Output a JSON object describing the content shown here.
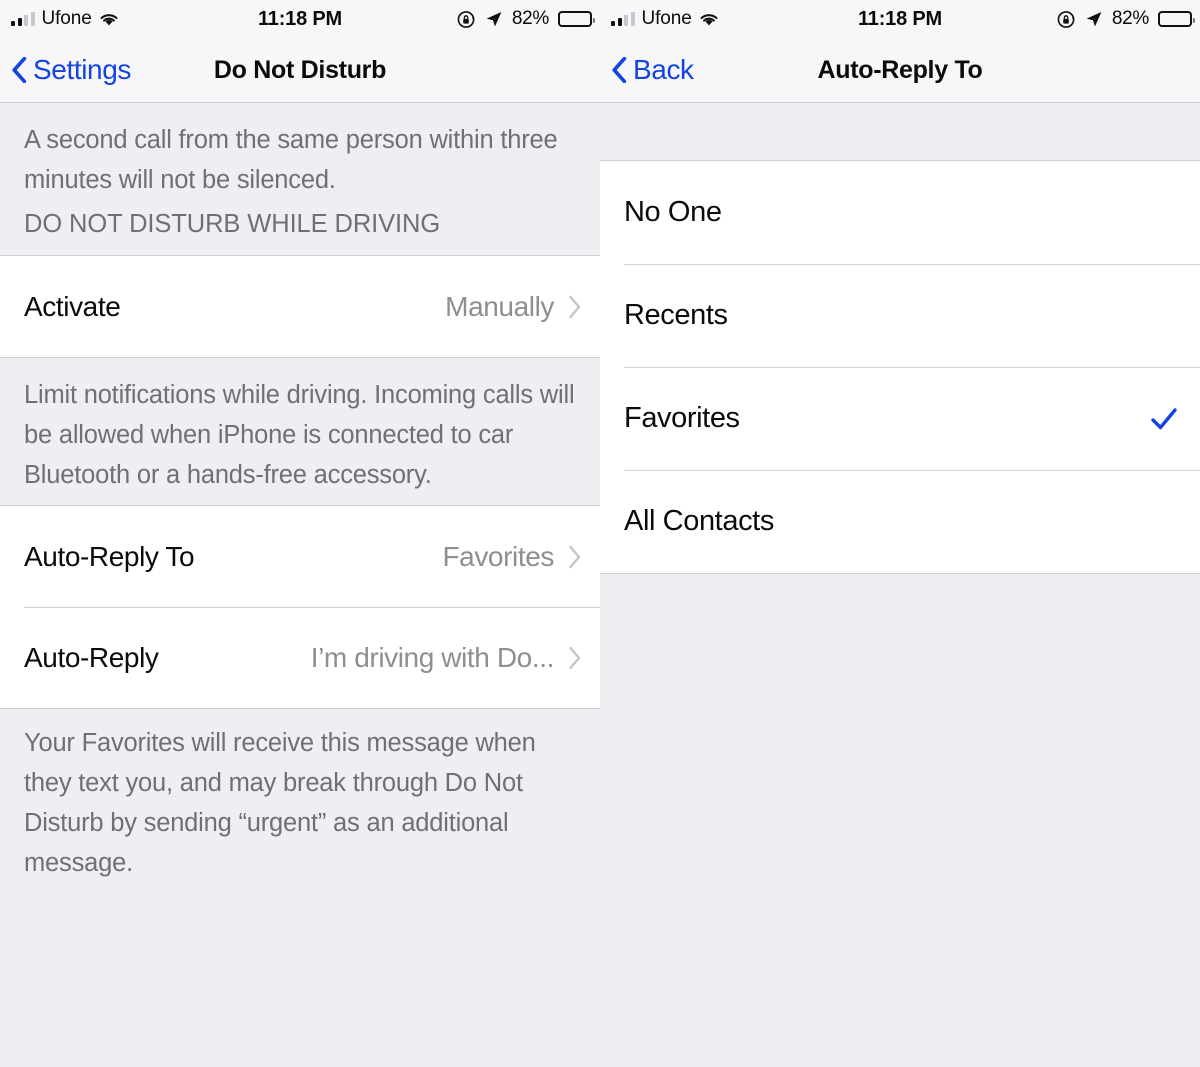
{
  "theme": {
    "accent_blue": "#1344e0",
    "background_gray": "#eeeef3",
    "card_white": "#ffffff",
    "separator": "#cfcfd4",
    "secondary_text": "#8e8e93",
    "footer_text": "#6f6f76"
  },
  "left_screen": {
    "status_bar": {
      "carrier": "Ufone",
      "signal_bars_filled": 2,
      "signal_bars_total": 4,
      "wifi_icon": "wifi-icon",
      "time": "11:18 PM",
      "rotation_lock_icon": "rotation-lock-icon",
      "location_icon": "location-arrow-icon",
      "battery_percent": "82%",
      "battery_icon": "battery-icon"
    },
    "nav": {
      "back_icon": "chevron-left-icon",
      "back_label": "Settings",
      "title": "Do Not Disturb"
    },
    "phone_call_footer": "A second call from the same person within three minutes will not be silenced.",
    "driving_section_header": "DO NOT DISTURB WHILE DRIVING",
    "activate_row": {
      "label": "Activate",
      "value": "Manually",
      "chevron_icon": "chevron-right-icon"
    },
    "driving_footer": "Limit notifications while driving. Incoming calls will be allowed when iPhone is connected to car Bluetooth or a hands-free accessory.",
    "auto_reply_rows": [
      {
        "label": "Auto-Reply To",
        "value": "Favorites",
        "chevron_icon": "chevron-right-icon"
      },
      {
        "label": "Auto-Reply",
        "value": "I’m driving with Do...",
        "chevron_icon": "chevron-right-icon"
      }
    ],
    "auto_reply_footer": "Your Favorites will receive this message when they text you, and may break through Do Not Disturb by sending “urgent” as an additional message."
  },
  "right_screen": {
    "status_bar": {
      "carrier": "Ufone",
      "signal_bars_filled": 2,
      "signal_bars_total": 4,
      "wifi_icon": "wifi-icon",
      "time": "11:18 PM",
      "rotation_lock_icon": "rotation-lock-icon",
      "location_icon": "location-arrow-icon",
      "battery_percent": "82%",
      "battery_icon": "battery-icon"
    },
    "nav": {
      "back_icon": "chevron-left-icon",
      "back_label": "Back",
      "title": "Auto-Reply To"
    },
    "options": [
      {
        "label": "No One",
        "selected": false
      },
      {
        "label": "Recents",
        "selected": false
      },
      {
        "label": "Favorites",
        "selected": true
      },
      {
        "label": "All Contacts",
        "selected": false
      }
    ],
    "checkmark_icon": "checkmark-icon"
  }
}
